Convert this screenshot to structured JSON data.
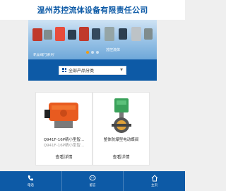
{
  "header": {
    "title": "温州苏控流体设备有限责任公司"
  },
  "banner": {
    "caption": "专业阀门系列",
    "brand": "苏控流体"
  },
  "category": {
    "label": "全部产品分类",
    "caret": "▼"
  },
  "products": [
    {
      "name": "Q941F-16P精小型智...",
      "name2": "Q941F-16P精小型智...",
      "detail": "查看详情"
    },
    {
      "name": "整体防爆型电动蝶阀",
      "name2": "",
      "detail": "查看详情"
    }
  ],
  "bottom_nav": [
    {
      "label": "电话",
      "icon": "phone-icon"
    },
    {
      "label": "留言",
      "icon": "message-icon"
    },
    {
      "label": "主页",
      "icon": "home-icon"
    }
  ],
  "colors": {
    "brand": "#0d5aa6",
    "accent": "#f39c12"
  }
}
